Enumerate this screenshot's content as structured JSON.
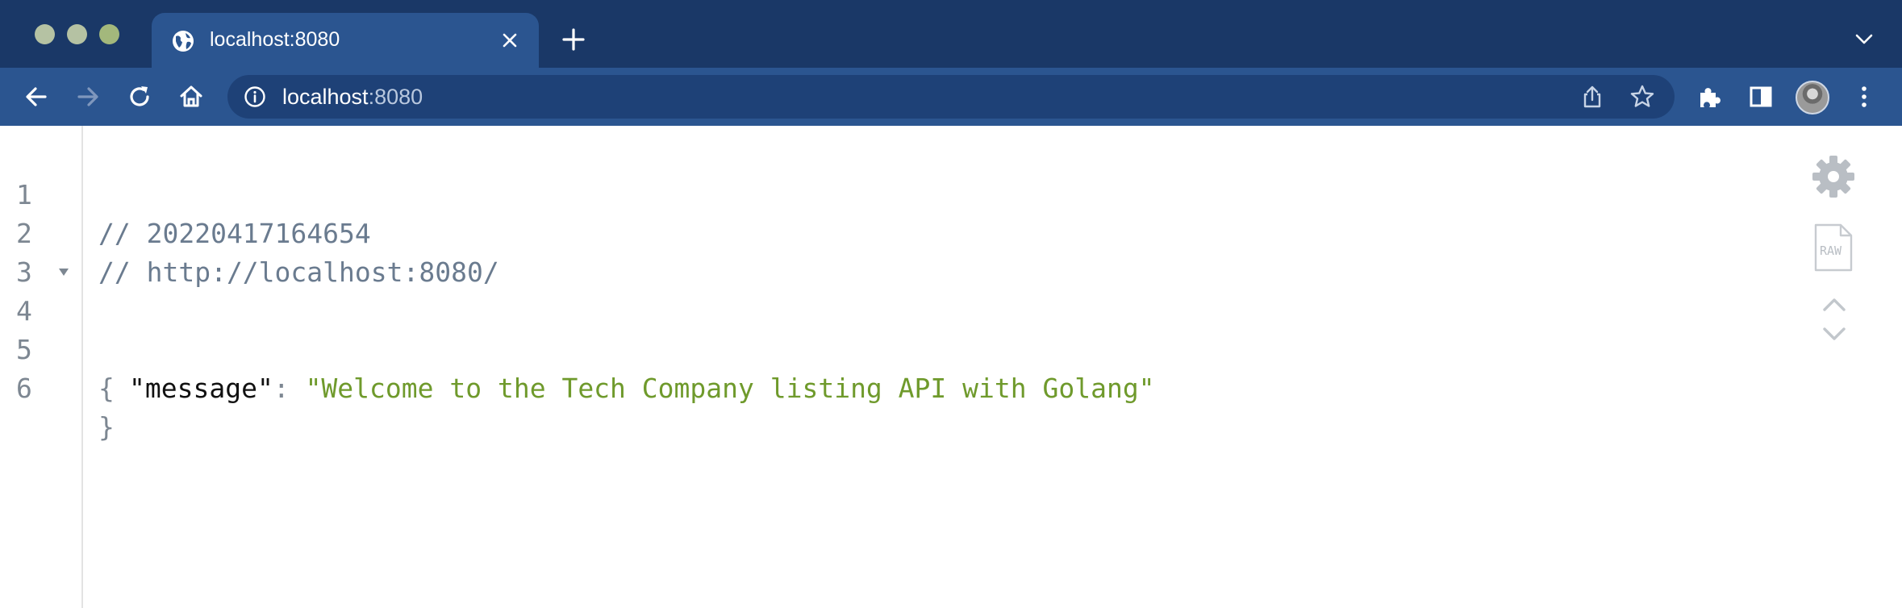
{
  "browser": {
    "tab": {
      "title": "localhost:8080"
    },
    "address_bar": {
      "host": "localhost",
      "port": ":8080"
    }
  },
  "viewer": {
    "lines": [
      {
        "num": "1",
        "text": "// 20220417164654",
        "kind": "comment"
      },
      {
        "num": "2",
        "text": "// http://localhost:8080/",
        "kind": "comment"
      },
      {
        "num": "3",
        "text": "",
        "kind": "blank"
      },
      {
        "num": "4",
        "text": "{",
        "kind": "open"
      },
      {
        "num": "5",
        "key": "\"message\"",
        "sep": ": ",
        "value": "\"Welcome to the Tech Company listing API with Golang\"",
        "kind": "pair"
      },
      {
        "num": "6",
        "text": "}",
        "kind": "close"
      }
    ],
    "icons": {
      "settings": "gear-icon",
      "raw": "raw-file-icon",
      "collapse": "chevron-up-icon",
      "expand": "chevron-down-icon"
    },
    "raw_label": "RAW"
  },
  "colors": {
    "tabstrip": "#1a3867",
    "toolbar": "#2b5590",
    "omnibox": "#1e4177",
    "comment": "#6a7b8f",
    "string": "#6f9a2c"
  }
}
